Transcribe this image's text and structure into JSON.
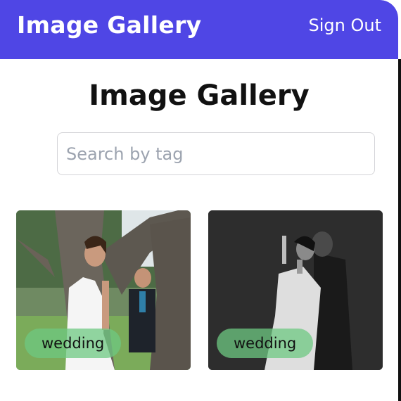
{
  "navbar": {
    "brand": "Image Gallery",
    "sign_out": "Sign Out",
    "color": "#4f46e5"
  },
  "main": {
    "title": "Image Gallery",
    "search": {
      "placeholder": "Search by tag",
      "value": ""
    }
  },
  "gallery": {
    "items": [
      {
        "tag": "wedding",
        "photo": "bride-and-groom-by-tree-photo",
        "style": "color"
      },
      {
        "tag": "wedding",
        "photo": "couple-embracing-photo",
        "style": "black-and-white"
      }
    ]
  }
}
